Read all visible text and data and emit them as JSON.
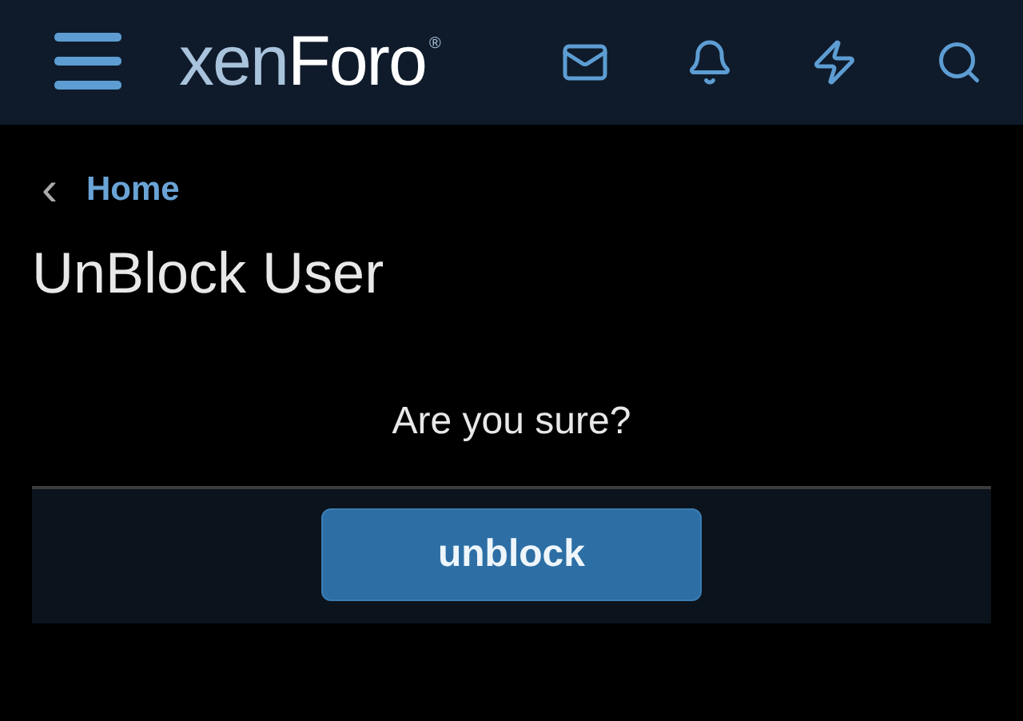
{
  "header": {
    "logo": {
      "first": "xen",
      "second": "Foro",
      "mark": "®"
    }
  },
  "breadcrumb": {
    "arrow": "‹",
    "label": "Home"
  },
  "title": "UnBlock User",
  "message": "Are you sure?",
  "buttons": [
    "unblock"
  ]
}
